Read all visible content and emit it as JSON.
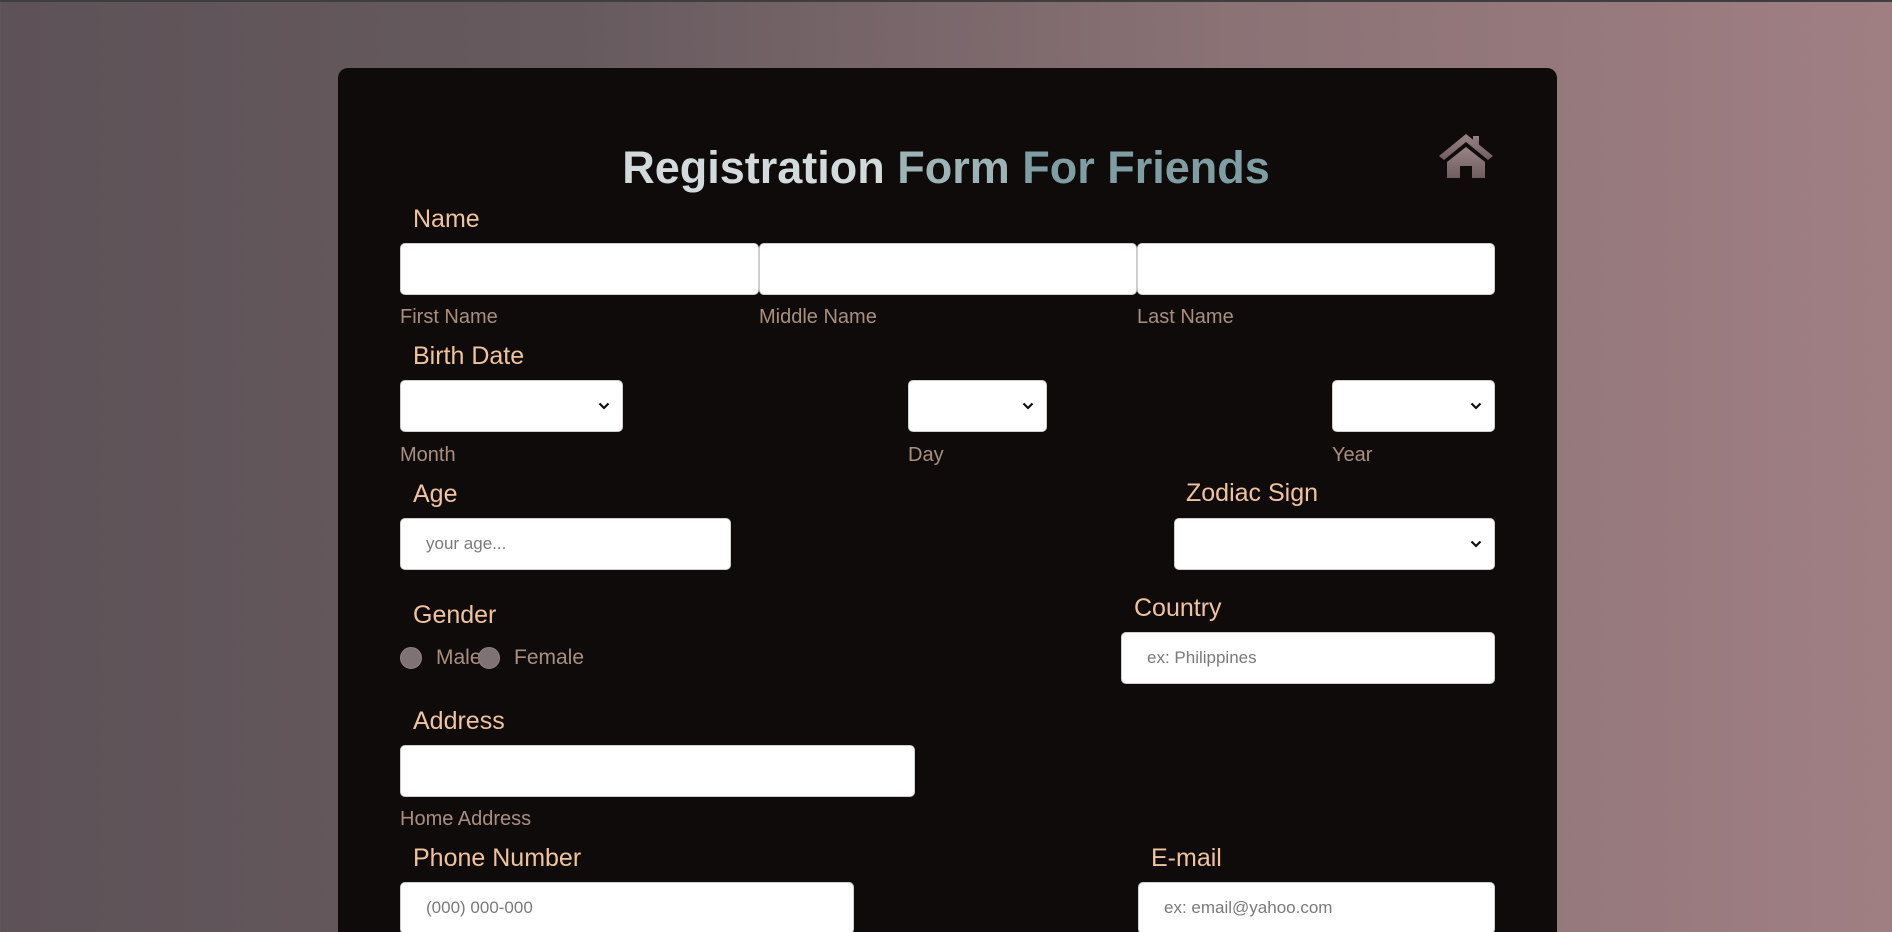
{
  "page": {
    "title_part1": "Registration",
    "title_part2": "Form",
    "title_part3": "For Friends",
    "home_icon": "home-icon"
  },
  "name": {
    "label": "Name",
    "first_sub": "First Name",
    "middle_sub": "Middle Name",
    "last_sub": "Last Name",
    "first_value": "",
    "middle_value": "",
    "last_value": ""
  },
  "birth_date": {
    "label": "Birth Date",
    "month_sub": "Month",
    "day_sub": "Day",
    "year_sub": "Year",
    "month_value": "",
    "day_value": "",
    "year_value": ""
  },
  "age": {
    "label": "Age",
    "placeholder": "your age...",
    "value": ""
  },
  "zodiac": {
    "label": "Zodiac Sign",
    "value": ""
  },
  "gender": {
    "label": "Gender",
    "options": [
      "Male",
      "Female"
    ]
  },
  "country": {
    "label": "Country",
    "placeholder": "ex: Philippines",
    "value": ""
  },
  "address": {
    "label": "Address",
    "sub": "Home Address",
    "value": ""
  },
  "phone": {
    "label": "Phone Number",
    "placeholder": "(000) 000-000",
    "value": ""
  },
  "email": {
    "label": "E-mail",
    "placeholder": "ex: email@yahoo.com",
    "value": ""
  },
  "colors": {
    "label": "#f0c49a",
    "sublabel": "#a98f80",
    "card": "#100b0b",
    "title_primary": "#d2dadb",
    "title_accent": "#7f9ea3"
  }
}
